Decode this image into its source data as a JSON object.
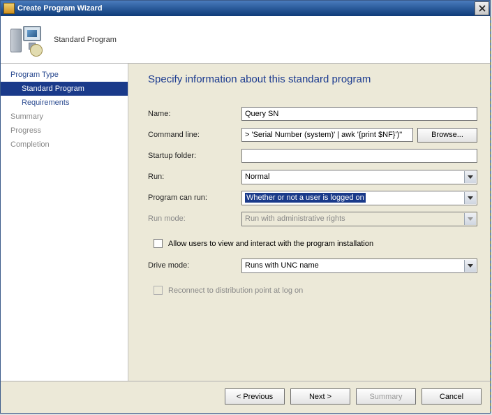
{
  "window": {
    "title": "Create Program Wizard"
  },
  "banner": {
    "title": "Standard Program"
  },
  "sidebar": {
    "items": [
      {
        "label": "Program Type",
        "kind": "top"
      },
      {
        "label": "Standard Program",
        "kind": "sub",
        "selected": true
      },
      {
        "label": "Requirements",
        "kind": "sub"
      },
      {
        "label": "Summary",
        "kind": "top",
        "faded": true
      },
      {
        "label": "Progress",
        "kind": "top",
        "faded": true
      },
      {
        "label": "Completion",
        "kind": "top",
        "faded": true
      }
    ]
  },
  "page": {
    "title": "Specify information about this standard program"
  },
  "form": {
    "name_label": "Name:",
    "name_value": "Query SN",
    "cmd_label": "Command line:",
    "cmd_value": "> 'Serial Number (system)' | awk '{print $NF}')\"",
    "browse_label": "Browse...",
    "startup_label": "Startup folder:",
    "startup_value": "",
    "run_label": "Run:",
    "run_value": "Normal",
    "canrun_label": "Program can run:",
    "canrun_value": "Whether or not a user is logged on",
    "runmode_label": "Run mode:",
    "runmode_value": "Run with administrative rights",
    "allow_label": "Allow users to view and interact with the program installation",
    "drive_label": "Drive mode:",
    "drive_value": "Runs with UNC name",
    "reconnect_label": "Reconnect to distribution point at log on"
  },
  "footer": {
    "previous": "< Previous",
    "next": "Next >",
    "summary": "Summary",
    "cancel": "Cancel"
  }
}
